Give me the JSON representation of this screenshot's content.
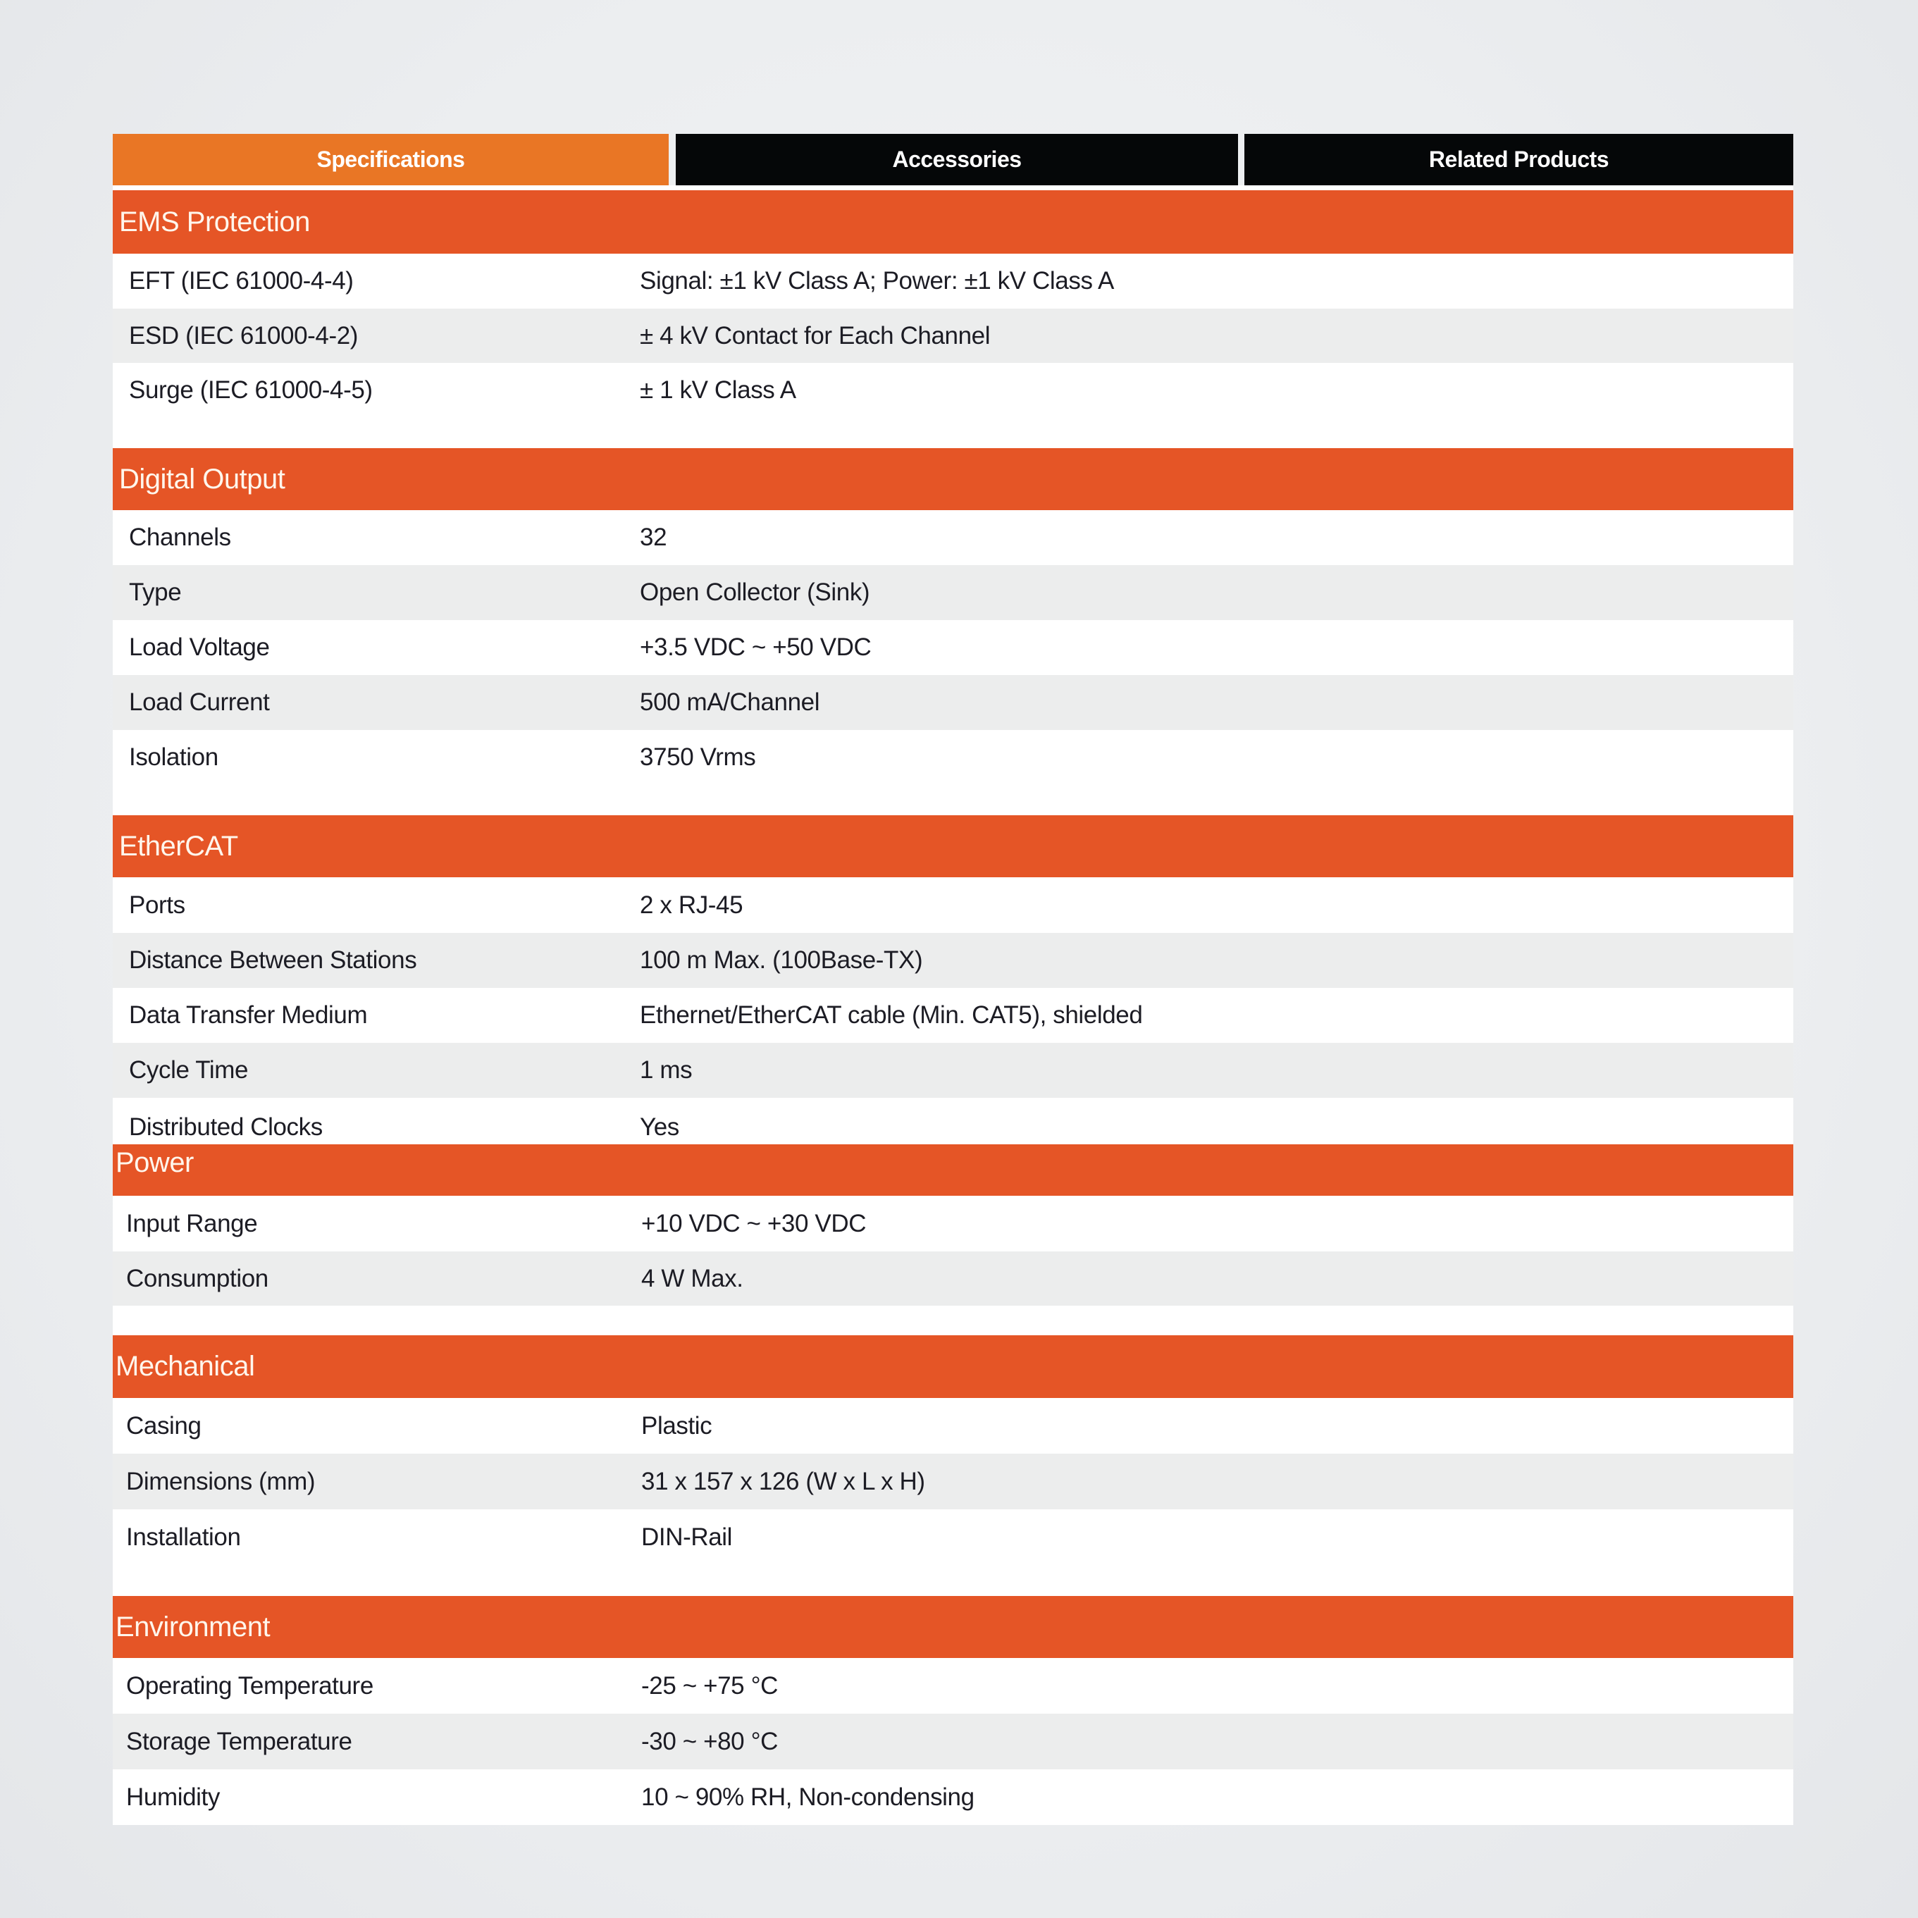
{
  "tabs": [
    {
      "label": "Specifications",
      "active": true
    },
    {
      "label": "Accessories",
      "active": false
    },
    {
      "label": "Related Products",
      "active": false
    }
  ],
  "colors": {
    "active_tab": "#e97625",
    "inactive_tab": "#050708",
    "section_header": "#e55526",
    "alt_row": "#eceded"
  },
  "sections": [
    {
      "title": "EMS Protection",
      "rows": [
        {
          "label": "EFT (IEC 61000-4-4)",
          "value": "Signal: ±1 kV Class A; Power: ±1 kV Class A"
        },
        {
          "label": "ESD (IEC 61000-4-2)",
          "value": "± 4 kV Contact for Each Channel"
        },
        {
          "label": "Surge (IEC 61000-4-5)",
          "value": "± 1 kV Class A"
        }
      ]
    },
    {
      "title": "Digital Output",
      "rows": [
        {
          "label": "Channels",
          "value": "32"
        },
        {
          "label": "Type",
          "value": "Open Collector (Sink)"
        },
        {
          "label": "Load Voltage",
          "value": "+3.5 VDC ~ +50 VDC"
        },
        {
          "label": "Load Current",
          "value": "500 mA/Channel"
        },
        {
          "label": "Isolation",
          "value": "3750 Vrms"
        }
      ]
    },
    {
      "title": "EtherCAT",
      "rows": [
        {
          "label": "Ports",
          "value": "2 x RJ-45"
        },
        {
          "label": "Distance Between Stations",
          "value": "100 m Max. (100Base-TX)"
        },
        {
          "label": "Data Transfer Medium",
          "value": "Ethernet/EtherCAT cable (Min. CAT5), shielded"
        },
        {
          "label": "Cycle Time",
          "value": "1 ms"
        },
        {
          "label": "Distributed Clocks",
          "value": "Yes"
        }
      ]
    },
    {
      "title": "Power",
      "rows": [
        {
          "label": "Input Range",
          "value": "+10 VDC ~ +30 VDC"
        },
        {
          "label": "Consumption",
          "value": "4 W Max."
        }
      ]
    },
    {
      "title": "Mechanical",
      "rows": [
        {
          "label": "Casing",
          "value": "Plastic"
        },
        {
          "label": "Dimensions (mm)",
          "value": "31 x 157 x 126 (W x L x H)"
        },
        {
          "label": "Installation",
          "value": "DIN-Rail"
        }
      ]
    },
    {
      "title": "Environment",
      "rows": [
        {
          "label": "Operating Temperature",
          "value": "-25 ~ +75 °C"
        },
        {
          "label": "Storage Temperature",
          "value": "-30 ~ +80 °C"
        },
        {
          "label": "Humidity",
          "value": "10 ~ 90% RH, Non-condensing"
        }
      ]
    }
  ]
}
